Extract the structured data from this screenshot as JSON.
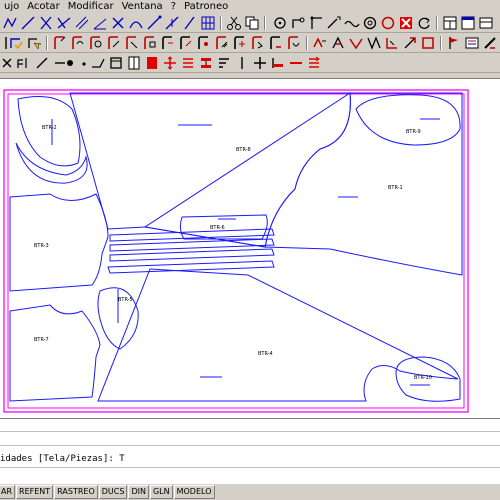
{
  "menubar": {
    "items": [
      "ujo",
      "Acotar",
      "Modificar",
      "Ventana",
      "?",
      "Patroneo"
    ]
  },
  "drawing": {
    "piece_labels": [
      {
        "id": "p1",
        "text": "BTR-2"
      },
      {
        "id": "p2",
        "text": "BTR-8"
      },
      {
        "id": "p3",
        "text": "BTR-1"
      },
      {
        "id": "p4",
        "text": "BTR-3"
      },
      {
        "id": "p5",
        "text": "BTR-7"
      },
      {
        "id": "p6",
        "text": "BTR-5"
      },
      {
        "id": "p7",
        "text": "BTR-4"
      },
      {
        "id": "p8",
        "text": "BTR-6"
      },
      {
        "id": "p9",
        "text": "BTR-9"
      },
      {
        "id": "p10",
        "text": "BTR-10"
      }
    ]
  },
  "command": {
    "line1": "",
    "line2": "",
    "line3": "idades [Tela/Piezas]: T",
    "line4": ""
  },
  "statusbar": {
    "buttons": [
      "AR",
      "REFENT",
      "RASTREO",
      "DUCS",
      "DIN",
      "GLN",
      "MODELO"
    ]
  },
  "colors": {
    "pattern_line": "#1a1aff",
    "cloth_border": "#ff00ff",
    "icon_red": "#e00000",
    "icon_blue": "#0000c0"
  }
}
